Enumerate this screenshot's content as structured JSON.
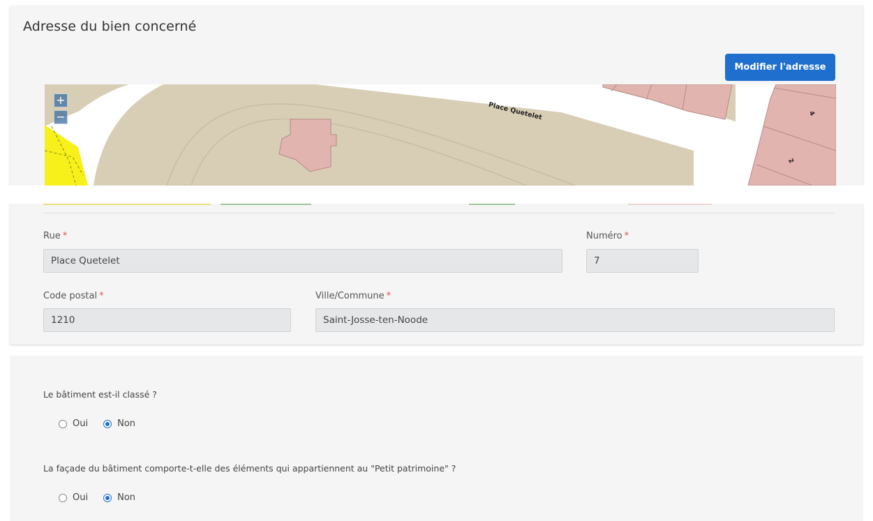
{
  "address_section": {
    "title": "Adresse du bien concerné",
    "modify_button": "Modifier l'adresse",
    "map": {
      "street_label": "Place Quetelet",
      "house_numbers": [
        "4",
        "2"
      ],
      "zoom_in": "+",
      "zoom_out": "−"
    },
    "fields": {
      "rue": {
        "label": "Rue",
        "value": "Place Quetelet"
      },
      "numero": {
        "label": "Numéro",
        "value": "7"
      },
      "code_postal": {
        "label": "Code postal",
        "value": "1210"
      },
      "ville": {
        "label": "Ville/Commune",
        "value": "Saint-Josse-ten-Noode"
      }
    },
    "required_marker": "*"
  },
  "questions": [
    {
      "text": "Le bâtiment est-il classé ?",
      "options": [
        "Oui",
        "Non"
      ],
      "selected": "Non"
    },
    {
      "text": "La façade du bâtiment comporte-t-elle des éléments qui appartiennent au \"Petit patrimoine\" ?",
      "options": [
        "Oui",
        "Non"
      ],
      "selected": "Non"
    }
  ],
  "colors": {
    "accent": "#1f6fcf",
    "required": "#d9534f",
    "map_ground": "#d8cdb5",
    "map_building": "#e2b4b0",
    "map_highlight": "#f7f01a"
  }
}
